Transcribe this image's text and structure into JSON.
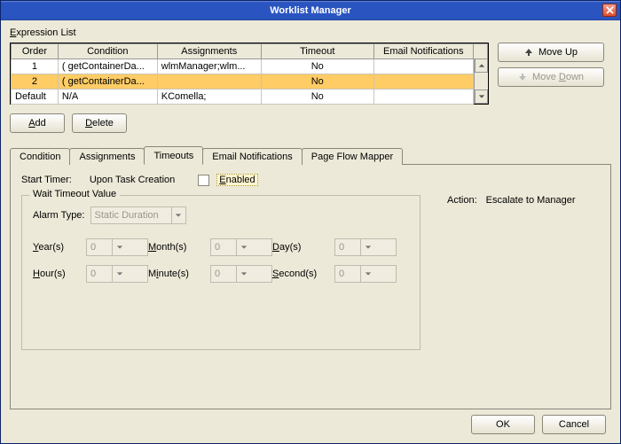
{
  "title": "Worklist Manager",
  "section_title": "Expression List",
  "section_title_ul": "E",
  "table": {
    "headers": {
      "order": "Order",
      "condition": "Condition",
      "assignments": "Assignments",
      "timeout": "Timeout",
      "email": "Email Notifications"
    },
    "rows": [
      {
        "order": "1",
        "condition": "( getContainerDa...",
        "assignments": "wlmManager;wlm...",
        "timeout": "No",
        "email": "",
        "selected": false
      },
      {
        "order": "2",
        "condition": "( getContainerDa...",
        "assignments": "",
        "timeout": "No",
        "email": "",
        "selected": true
      },
      {
        "order": "Default",
        "condition": "N/A",
        "assignments": "KComella;",
        "timeout": "No",
        "email": "",
        "selected": false
      }
    ]
  },
  "buttons": {
    "move_up": "Move Up",
    "move_down": "Move Down",
    "add": "Add",
    "add_ul": "A",
    "delete": "Delete",
    "delete_ul": "D",
    "ok": "OK",
    "cancel": "Cancel"
  },
  "tabs": [
    "Condition",
    "Assignments",
    "Timeouts",
    "Email Notifications",
    "Page Flow Mapper"
  ],
  "active_tab": 2,
  "timeouts": {
    "start_label": "Start Timer:",
    "start_value": "Upon Task Creation",
    "enabled_label": "Enabled",
    "enabled_ul": "E",
    "enabled": false,
    "group_title": "Wait Timeout Value",
    "alarm_label": "Alarm Type:",
    "alarm_value": "Static Duration",
    "fields": {
      "year": {
        "label": "Year(s)",
        "ul": "Y",
        "value": "0"
      },
      "month": {
        "label": "Month(s)",
        "ul": "M",
        "value": "0"
      },
      "day": {
        "label": "Day(s)",
        "ul": "D",
        "value": "0"
      },
      "hour": {
        "label": "Hour(s)",
        "ul": "H",
        "value": "0"
      },
      "minute": {
        "label": "Minute(s)",
        "ul": "i",
        "value": "0"
      },
      "second": {
        "label": "Second(s)",
        "ul": "S",
        "value": "0"
      }
    },
    "action_label": "Action:",
    "action_value": "Escalate to Manager"
  }
}
